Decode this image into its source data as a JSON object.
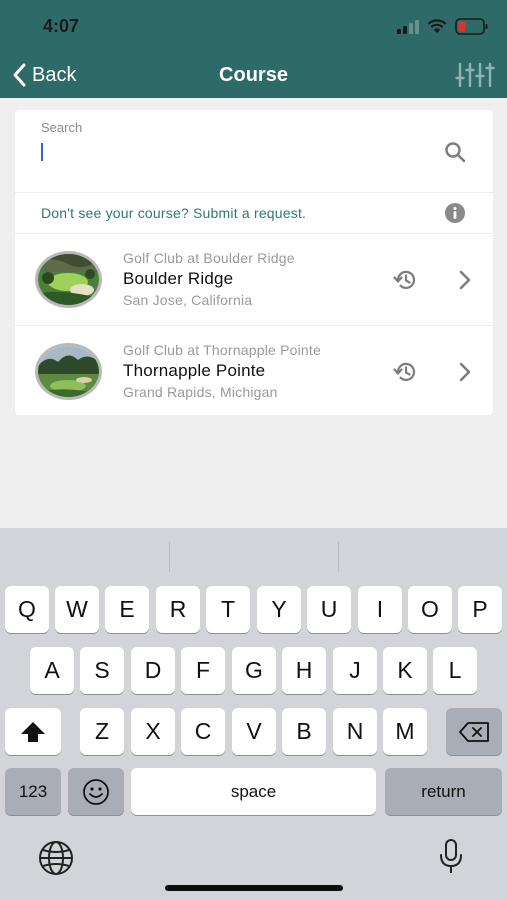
{
  "status_bar": {
    "time": "4:07"
  },
  "nav": {
    "back_label": "Back",
    "title": "Course"
  },
  "search": {
    "label": "Search",
    "placeholder": "",
    "value": ""
  },
  "request_link": "Don't see your course? Submit a request.",
  "courses": [
    {
      "club": "Golf Club at Boulder Ridge",
      "name": "Boulder Ridge",
      "location": "San Jose, California"
    },
    {
      "club": "Golf Club at Thornapple Pointe",
      "name": "Thornapple Pointe",
      "location": "Grand Rapids, Michigan"
    }
  ],
  "keyboard": {
    "row1": [
      "Q",
      "W",
      "E",
      "R",
      "T",
      "Y",
      "U",
      "I",
      "O",
      "P"
    ],
    "row2": [
      "A",
      "S",
      "D",
      "F",
      "G",
      "H",
      "J",
      "K",
      "L"
    ],
    "row3": [
      "Z",
      "X",
      "C",
      "V",
      "B",
      "N",
      "M"
    ],
    "numbers_key": "123",
    "space_key": "space",
    "return_key": "return"
  },
  "colors": {
    "header": "#2e6b68",
    "link": "#2e7a6f",
    "cursor": "#3a63d9"
  }
}
